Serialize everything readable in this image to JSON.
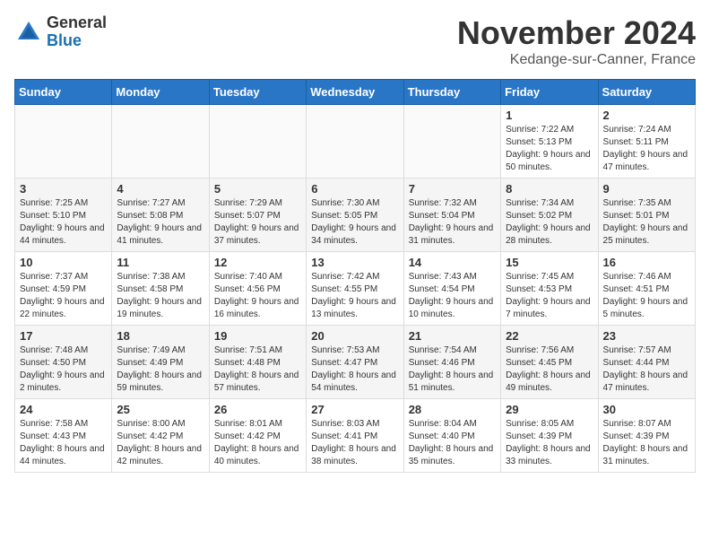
{
  "logo": {
    "general": "General",
    "blue": "Blue"
  },
  "title": "November 2024",
  "location": "Kedange-sur-Canner, France",
  "days_header": [
    "Sunday",
    "Monday",
    "Tuesday",
    "Wednesday",
    "Thursday",
    "Friday",
    "Saturday"
  ],
  "weeks": [
    [
      {
        "day": "",
        "info": ""
      },
      {
        "day": "",
        "info": ""
      },
      {
        "day": "",
        "info": ""
      },
      {
        "day": "",
        "info": ""
      },
      {
        "day": "",
        "info": ""
      },
      {
        "day": "1",
        "info": "Sunrise: 7:22 AM\nSunset: 5:13 PM\nDaylight: 9 hours\nand 50 minutes."
      },
      {
        "day": "2",
        "info": "Sunrise: 7:24 AM\nSunset: 5:11 PM\nDaylight: 9 hours\nand 47 minutes."
      }
    ],
    [
      {
        "day": "3",
        "info": "Sunrise: 7:25 AM\nSunset: 5:10 PM\nDaylight: 9 hours\nand 44 minutes."
      },
      {
        "day": "4",
        "info": "Sunrise: 7:27 AM\nSunset: 5:08 PM\nDaylight: 9 hours\nand 41 minutes."
      },
      {
        "day": "5",
        "info": "Sunrise: 7:29 AM\nSunset: 5:07 PM\nDaylight: 9 hours\nand 37 minutes."
      },
      {
        "day": "6",
        "info": "Sunrise: 7:30 AM\nSunset: 5:05 PM\nDaylight: 9 hours\nand 34 minutes."
      },
      {
        "day": "7",
        "info": "Sunrise: 7:32 AM\nSunset: 5:04 PM\nDaylight: 9 hours\nand 31 minutes."
      },
      {
        "day": "8",
        "info": "Sunrise: 7:34 AM\nSunset: 5:02 PM\nDaylight: 9 hours\nand 28 minutes."
      },
      {
        "day": "9",
        "info": "Sunrise: 7:35 AM\nSunset: 5:01 PM\nDaylight: 9 hours\nand 25 minutes."
      }
    ],
    [
      {
        "day": "10",
        "info": "Sunrise: 7:37 AM\nSunset: 4:59 PM\nDaylight: 9 hours\nand 22 minutes."
      },
      {
        "day": "11",
        "info": "Sunrise: 7:38 AM\nSunset: 4:58 PM\nDaylight: 9 hours\nand 19 minutes."
      },
      {
        "day": "12",
        "info": "Sunrise: 7:40 AM\nSunset: 4:56 PM\nDaylight: 9 hours\nand 16 minutes."
      },
      {
        "day": "13",
        "info": "Sunrise: 7:42 AM\nSunset: 4:55 PM\nDaylight: 9 hours\nand 13 minutes."
      },
      {
        "day": "14",
        "info": "Sunrise: 7:43 AM\nSunset: 4:54 PM\nDaylight: 9 hours\nand 10 minutes."
      },
      {
        "day": "15",
        "info": "Sunrise: 7:45 AM\nSunset: 4:53 PM\nDaylight: 9 hours\nand 7 minutes."
      },
      {
        "day": "16",
        "info": "Sunrise: 7:46 AM\nSunset: 4:51 PM\nDaylight: 9 hours\nand 5 minutes."
      }
    ],
    [
      {
        "day": "17",
        "info": "Sunrise: 7:48 AM\nSunset: 4:50 PM\nDaylight: 9 hours\nand 2 minutes."
      },
      {
        "day": "18",
        "info": "Sunrise: 7:49 AM\nSunset: 4:49 PM\nDaylight: 8 hours\nand 59 minutes."
      },
      {
        "day": "19",
        "info": "Sunrise: 7:51 AM\nSunset: 4:48 PM\nDaylight: 8 hours\nand 57 minutes."
      },
      {
        "day": "20",
        "info": "Sunrise: 7:53 AM\nSunset: 4:47 PM\nDaylight: 8 hours\nand 54 minutes."
      },
      {
        "day": "21",
        "info": "Sunrise: 7:54 AM\nSunset: 4:46 PM\nDaylight: 8 hours\nand 51 minutes."
      },
      {
        "day": "22",
        "info": "Sunrise: 7:56 AM\nSunset: 4:45 PM\nDaylight: 8 hours\nand 49 minutes."
      },
      {
        "day": "23",
        "info": "Sunrise: 7:57 AM\nSunset: 4:44 PM\nDaylight: 8 hours\nand 47 minutes."
      }
    ],
    [
      {
        "day": "24",
        "info": "Sunrise: 7:58 AM\nSunset: 4:43 PM\nDaylight: 8 hours\nand 44 minutes."
      },
      {
        "day": "25",
        "info": "Sunrise: 8:00 AM\nSunset: 4:42 PM\nDaylight: 8 hours\nand 42 minutes."
      },
      {
        "day": "26",
        "info": "Sunrise: 8:01 AM\nSunset: 4:42 PM\nDaylight: 8 hours\nand 40 minutes."
      },
      {
        "day": "27",
        "info": "Sunrise: 8:03 AM\nSunset: 4:41 PM\nDaylight: 8 hours\nand 38 minutes."
      },
      {
        "day": "28",
        "info": "Sunrise: 8:04 AM\nSunset: 4:40 PM\nDaylight: 8 hours\nand 35 minutes."
      },
      {
        "day": "29",
        "info": "Sunrise: 8:05 AM\nSunset: 4:39 PM\nDaylight: 8 hours\nand 33 minutes."
      },
      {
        "day": "30",
        "info": "Sunrise: 8:07 AM\nSunset: 4:39 PM\nDaylight: 8 hours\nand 31 minutes."
      }
    ]
  ]
}
